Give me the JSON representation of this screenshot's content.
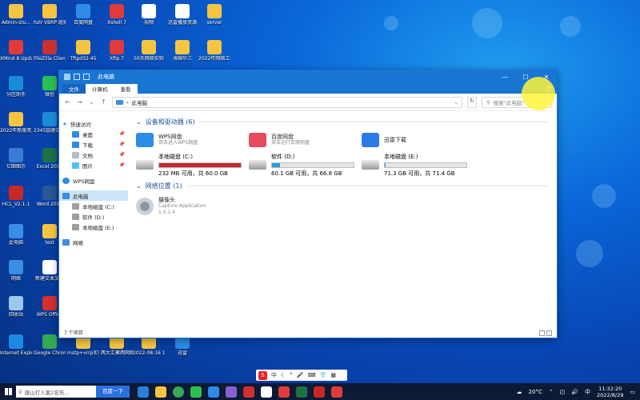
{
  "desktop_icons": [
    {
      "label": "Admin-stu...",
      "color": "#f5c542"
    },
    {
      "label": "hzlr VBRP 组播服务...",
      "color": "#f5c542"
    },
    {
      "label": "百度网盘",
      "color": "#2e8be6"
    },
    {
      "label": "Xshell 7",
      "color": "#e03a3a"
    },
    {
      "label": "视频",
      "color": "#ffffff"
    },
    {
      "label": "迅雷播放资源",
      "color": "#ffffff"
    },
    {
      "label": "server",
      "color": "#f5c542"
    },
    {
      "label": "XMind 8 Update 9",
      "color": "#e03a3a"
    },
    {
      "label": "FileZilla Client",
      "color": "#c83232"
    },
    {
      "label": "Tftpd32-45",
      "color": "#f5c542"
    },
    {
      "label": "Xftp 7",
      "color": "#e03a3a"
    },
    {
      "label": "50天网络实验",
      "color": "#f5c542"
    },
    {
      "label": "海绵华三",
      "color": "#f5c542"
    },
    {
      "label": "2022年网络工程...",
      "color": "#f5c542"
    },
    {
      "label": "分区助手",
      "color": "#1b8dd8"
    },
    {
      "label": "微信",
      "color": "#2bbf52"
    },
    {
      "label": "2022年新版常用工具箱",
      "color": "#f5c542"
    },
    {
      "label": "2345加速浏览器",
      "color": "#1b8dd8"
    },
    {
      "label": "亿图图示",
      "color": "#3a7bd5"
    },
    {
      "label": "Excel 2016",
      "color": "#1e7145"
    },
    {
      "label": "HCL_V2.1.1",
      "color": "#c62828"
    },
    {
      "label": "Word 2016",
      "color": "#2b5797"
    },
    {
      "label": "此电脑",
      "color": "#3a8ee6"
    },
    {
      "label": "test",
      "color": "#f5c542"
    },
    {
      "label": "网络",
      "color": "#3a8ee6"
    },
    {
      "label": "新建文本文档",
      "color": "#ffffff"
    },
    {
      "label": "回收站",
      "color": "#9ec8ee"
    },
    {
      "label": "WPS Office",
      "color": "#d32f2f"
    },
    {
      "label": "Internet Explorer",
      "color": "#1e88e5"
    },
    {
      "label": "Google Chrome",
      "color": "#34a853"
    },
    {
      "label": "mstp+vrrp实验",
      "color": "#f5c542"
    },
    {
      "label": "两大汇聚两网络mstp...",
      "color": "#f5c542"
    },
    {
      "label": "2022-08-16 15_35_31...",
      "color": "#f5c542"
    },
    {
      "label": "迅雷",
      "color": "#2e8be6"
    }
  ],
  "window": {
    "title": "此电脑",
    "ribbon_tabs": [
      "文件",
      "计算机",
      "查看"
    ],
    "help": "?",
    "address": {
      "path": "此电脑",
      "search_placeholder": "搜索\"此电脑\""
    },
    "nav": {
      "quick_access": "快速访问",
      "quick_items": [
        "桌面",
        "下载",
        "文档",
        "图片"
      ],
      "wps": "WPS网盘",
      "this_pc": "此电脑",
      "drives": [
        "本地磁盘 (C:)",
        "软件 (D:)",
        "本地磁盘 (E:)"
      ],
      "network": "网络"
    },
    "devices_section": {
      "title": "设备和驱动器 (6)"
    },
    "apps": [
      {
        "name": "WPS网盘",
        "sub": "双击进入WPS网盘",
        "color": "#2e8be6"
      },
      {
        "name": "百度网盘",
        "sub": "双击运行百度网盘",
        "color": "#e84a5f"
      },
      {
        "name": "迅雷下载",
        "sub": "",
        "color": "#2b7be4"
      }
    ],
    "drives": [
      {
        "name": "本地磁盘 (C:)",
        "free": "232 MB 可用，共 60.0 GB",
        "used_fraction": 0.996,
        "bar_color": "#c9252e"
      },
      {
        "name": "软件 (D:)",
        "free": "60.1 GB 可用，共 66.8 GB",
        "used_fraction": 0.1,
        "bar_color": "#26a0da"
      },
      {
        "name": "本地磁盘 (E:)",
        "free": "71.3 GB 可用，共 71.4 GB",
        "used_fraction": 0.01,
        "bar_color": "#26a0da"
      }
    ],
    "network_section": {
      "title": "网络位置 (1)"
    },
    "network_item": {
      "name": "摄像头",
      "sub1": "Capture Application",
      "sub2": "1.0.1.4"
    },
    "status": "7 个项目"
  },
  "taskbar": {
    "search_placeholder": "唐山打人案2名伤...",
    "search_button": "百度一下",
    "weather": "20°C",
    "ime_char": "中",
    "time": "11:32:20",
    "date": "2022/8/29"
  }
}
